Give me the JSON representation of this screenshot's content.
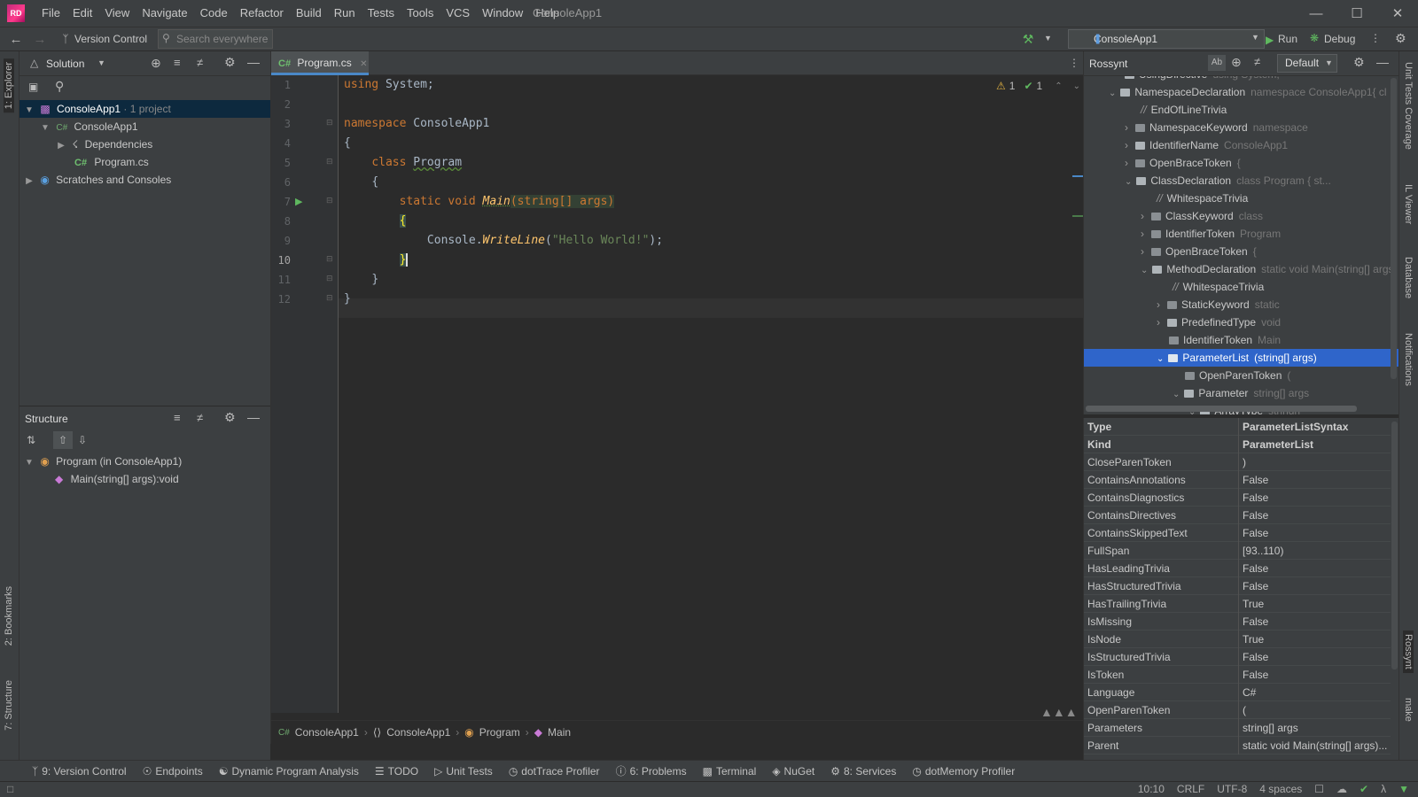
{
  "app": {
    "logo": "RD",
    "title": "ConsoleApp1"
  },
  "menu": [
    "File",
    "Edit",
    "View",
    "Navigate",
    "Code",
    "Refactor",
    "Build",
    "Run",
    "Tests",
    "Tools",
    "VCS",
    "Window",
    "Help"
  ],
  "toolbar": {
    "vcs": "Version Control",
    "search_placeholder": "Search everywhere",
    "run_config": "ConsoleApp1",
    "run": "Run",
    "debug": "Debug"
  },
  "explorer": {
    "mode": "Solution",
    "items": [
      {
        "label": "ConsoleApp1",
        "meta": " · 1 project"
      },
      {
        "label": "ConsoleApp1"
      },
      {
        "label": "Dependencies"
      },
      {
        "label": "Program.cs",
        "badge": "C#"
      },
      {
        "label": "Scratches and Consoles"
      }
    ]
  },
  "structure": {
    "title": "Structure",
    "items": [
      {
        "label": "Program (in ConsoleApp1)"
      },
      {
        "label": "Main(string[] args):void"
      }
    ]
  },
  "editor": {
    "tab": "Program.cs",
    "tab_badge": "C#",
    "warnings": "1",
    "ok": "1",
    "line_numbers": [
      "1",
      "2",
      "3",
      "4",
      "5",
      "6",
      "7",
      "8",
      "9",
      "10",
      "11",
      "12"
    ],
    "code": {
      "l1_kw": "using",
      "l1_rest": " System;",
      "l3_kw": "namespace",
      "l3_rest": " ConsoleApp1",
      "l4": "{",
      "l5_kw": "class",
      "l5_name": "Program",
      "l6": "{",
      "l7_kw": "static void",
      "l7_name": "Main",
      "l7_params": "(string[] args)",
      "l8": "{",
      "l9_pre": "Console.",
      "l9_mth": "WriteLine",
      "l9_str": "\"Hello World!\"",
      "l9_end": ");",
      "l10": "}",
      "l11": "}",
      "l12": "}"
    },
    "breadcrumb": [
      "ConsoleApp1",
      "ConsoleApp1",
      "Program",
      "Main"
    ]
  },
  "rossynt": {
    "title": "Rossynt",
    "mode": "Default",
    "nodes": [
      {
        "label": "UsingDirective",
        "desc": "using System;"
      },
      {
        "label": "NamespaceDeclaration",
        "desc": "namespace ConsoleApp1{   cl"
      },
      {
        "label": "EndOfLineTrivia",
        "desc": ""
      },
      {
        "label": "NamespaceKeyword",
        "desc": "namespace"
      },
      {
        "label": "IdentifierName",
        "desc": "ConsoleApp1"
      },
      {
        "label": "OpenBraceToken",
        "desc": "{"
      },
      {
        "label": "ClassDeclaration",
        "desc": "class Program    {       st..."
      },
      {
        "label": "WhitespaceTrivia",
        "desc": ""
      },
      {
        "label": "ClassKeyword",
        "desc": "class"
      },
      {
        "label": "IdentifierToken",
        "desc": "Program"
      },
      {
        "label": "OpenBraceToken",
        "desc": "{"
      },
      {
        "label": "MethodDeclaration",
        "desc": "static void Main(string[] args"
      },
      {
        "label": "WhitespaceTrivia",
        "desc": ""
      },
      {
        "label": "StaticKeyword",
        "desc": "static"
      },
      {
        "label": "PredefinedType",
        "desc": "void"
      },
      {
        "label": "IdentifierToken",
        "desc": "Main"
      },
      {
        "label": "ParameterList",
        "desc": "(string[] args)"
      },
      {
        "label": "OpenParenToken",
        "desc": "("
      },
      {
        "label": "Parameter",
        "desc": "string[] args"
      },
      {
        "label": "ArrayType",
        "desc": "string[]"
      }
    ],
    "props": [
      {
        "k": "Type",
        "v": "ParameterListSyntax"
      },
      {
        "k": "Kind",
        "v": "ParameterList"
      },
      {
        "k": "CloseParenToken",
        "v": ")"
      },
      {
        "k": "ContainsAnnotations",
        "v": "False"
      },
      {
        "k": "ContainsDiagnostics",
        "v": "False"
      },
      {
        "k": "ContainsDirectives",
        "v": "False"
      },
      {
        "k": "ContainsSkippedText",
        "v": "False"
      },
      {
        "k": "FullSpan",
        "v": "[93..110)"
      },
      {
        "k": "HasLeadingTrivia",
        "v": "False"
      },
      {
        "k": "HasStructuredTrivia",
        "v": "False"
      },
      {
        "k": "HasTrailingTrivia",
        "v": "True"
      },
      {
        "k": "IsMissing",
        "v": "False"
      },
      {
        "k": "IsNode",
        "v": "True"
      },
      {
        "k": "IsStructuredTrivia",
        "v": "False"
      },
      {
        "k": "IsToken",
        "v": "False"
      },
      {
        "k": "Language",
        "v": "C#"
      },
      {
        "k": "OpenParenToken",
        "v": "("
      },
      {
        "k": "Parameters",
        "v": "string[] args"
      },
      {
        "k": "Parent",
        "v": "static void Main(string[] args)..."
      }
    ]
  },
  "left_stripe": [
    "1: Explorer",
    "2: Bookmarks",
    "7: Structure"
  ],
  "right_stripe": [
    "Unit Tests Coverage",
    "IL Viewer",
    "Database",
    "Notifications",
    "Rossynt",
    "make"
  ],
  "toolwindows": [
    "9: Version Control",
    "Endpoints",
    "Dynamic Program Analysis",
    "TODO",
    "Unit Tests",
    "dotTrace Profiler",
    "6: Problems",
    "Terminal",
    "NuGet",
    "8: Services",
    "dotMemory Profiler"
  ],
  "status": {
    "pos": "10:10",
    "eol": "CRLF",
    "enc": "UTF-8",
    "indent": "4 spaces"
  }
}
